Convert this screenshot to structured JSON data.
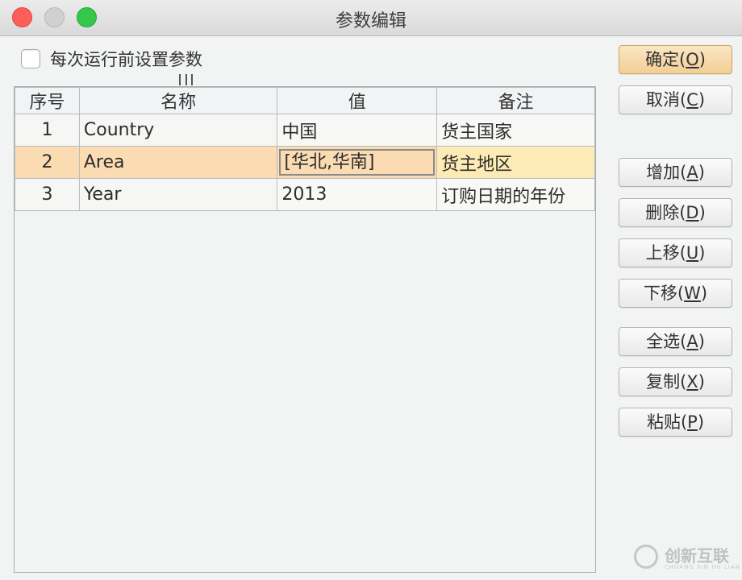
{
  "window": {
    "title": "参数编辑"
  },
  "options": {
    "set_before_run_label": "每次运行前设置参数",
    "set_before_run_checked": false
  },
  "table": {
    "headers": {
      "index": "序号",
      "name": "名称",
      "value": "值",
      "note": "备注"
    },
    "rows": [
      {
        "index": "1",
        "name": "Country",
        "value": "中国",
        "note": "货主国家"
      },
      {
        "index": "2",
        "name": "Area",
        "value": "[华北,华南]",
        "note": "货主地区"
      },
      {
        "index": "3",
        "name": "Year",
        "value": "2013",
        "note": "订购日期的年份"
      }
    ],
    "selected_row": 2
  },
  "buttons": {
    "ok": {
      "label": "确定(",
      "mnemonic": "O",
      "close": ")"
    },
    "cancel": {
      "label": "取消(",
      "mnemonic": "C",
      "close": ")"
    },
    "add": {
      "label": "增加(",
      "mnemonic": "A",
      "close": ")"
    },
    "delete": {
      "label": "删除(",
      "mnemonic": "D",
      "close": ")"
    },
    "move_up": {
      "label": "上移(",
      "mnemonic": "U",
      "close": ")"
    },
    "move_down": {
      "label": "下移(",
      "mnemonic": "W",
      "close": ")"
    },
    "select_all": {
      "label": "全选(",
      "mnemonic": "A",
      "close": ")"
    },
    "copy": {
      "label": "复制(",
      "mnemonic": "X",
      "close": ")"
    },
    "paste": {
      "label": "粘贴(",
      "mnemonic": "P",
      "close": ")"
    }
  },
  "watermark": {
    "text": "创新互联",
    "sub": "CHUANG XIN HU LIAN"
  }
}
